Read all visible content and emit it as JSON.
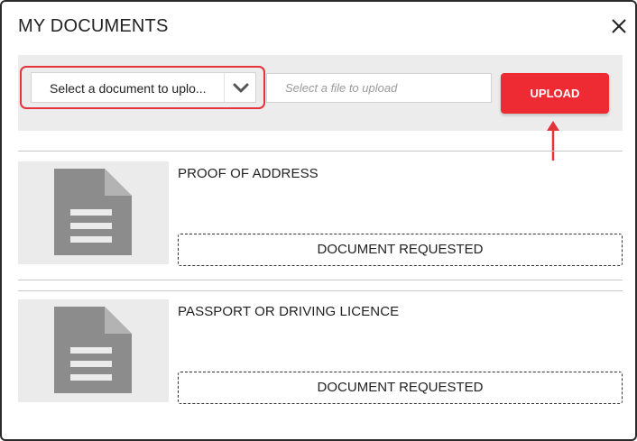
{
  "modal": {
    "title": "MY DOCUMENTS",
    "close_icon": "close-icon"
  },
  "toolbar": {
    "select_placeholder": "Select a document to uplo...",
    "chevron_icon": "chevron-down-icon",
    "file_placeholder": "Select a file to upload",
    "upload_label": "UPLOAD",
    "highlight_color": "#e5333b",
    "upload_color": "#ee2b33"
  },
  "documents": [
    {
      "name": "PROOF OF ADDRESS",
      "status": "DOCUMENT REQUESTED",
      "icon": "document-icon"
    },
    {
      "name": "PASSPORT OR DRIVING LICENCE",
      "status": "DOCUMENT REQUESTED",
      "icon": "document-icon"
    }
  ]
}
